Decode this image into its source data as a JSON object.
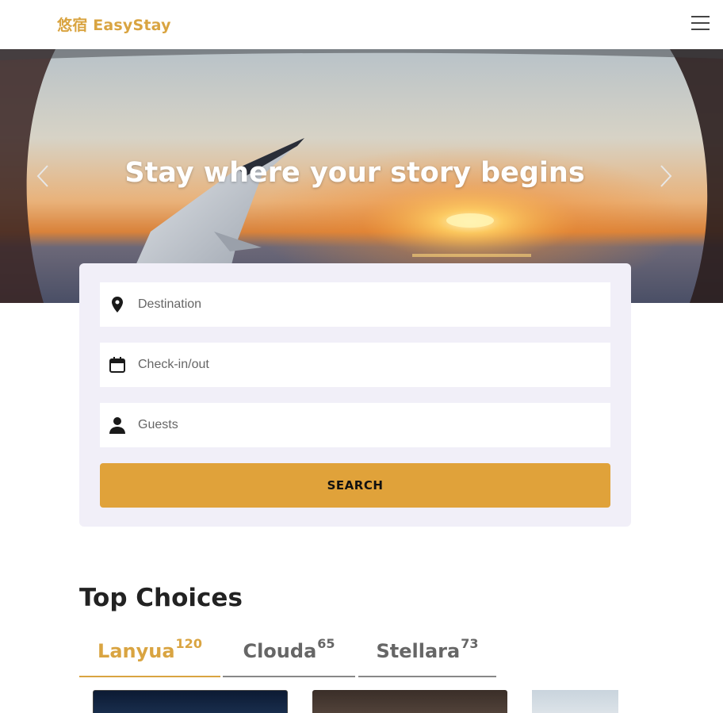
{
  "header": {
    "brand": "悠宿 EasyStay",
    "menu_icon": "hamburger-menu-icon"
  },
  "hero": {
    "title": "Stay where your story begins",
    "prev_icon": "chevron-left-icon",
    "next_icon": "chevron-right-icon"
  },
  "search": {
    "destination_placeholder": "Destination",
    "checkin_placeholder": "Check-in/out",
    "guests_placeholder": "Guests",
    "button_label": "SEARCH",
    "destination_icon": "map-pin-icon",
    "checkin_icon": "calendar-icon",
    "guests_icon": "person-icon"
  },
  "top_choices": {
    "title": "Top Choices",
    "tabs": [
      {
        "label": "Lanyua",
        "count": "120",
        "active": true
      },
      {
        "label": "Clouda",
        "count": "65",
        "active": false
      },
      {
        "label": "Stellara",
        "count": "73",
        "active": false
      }
    ]
  },
  "colors": {
    "brand": "#d9a441",
    "button": "#e0a23a",
    "panel_bg": "#f1eff8"
  }
}
